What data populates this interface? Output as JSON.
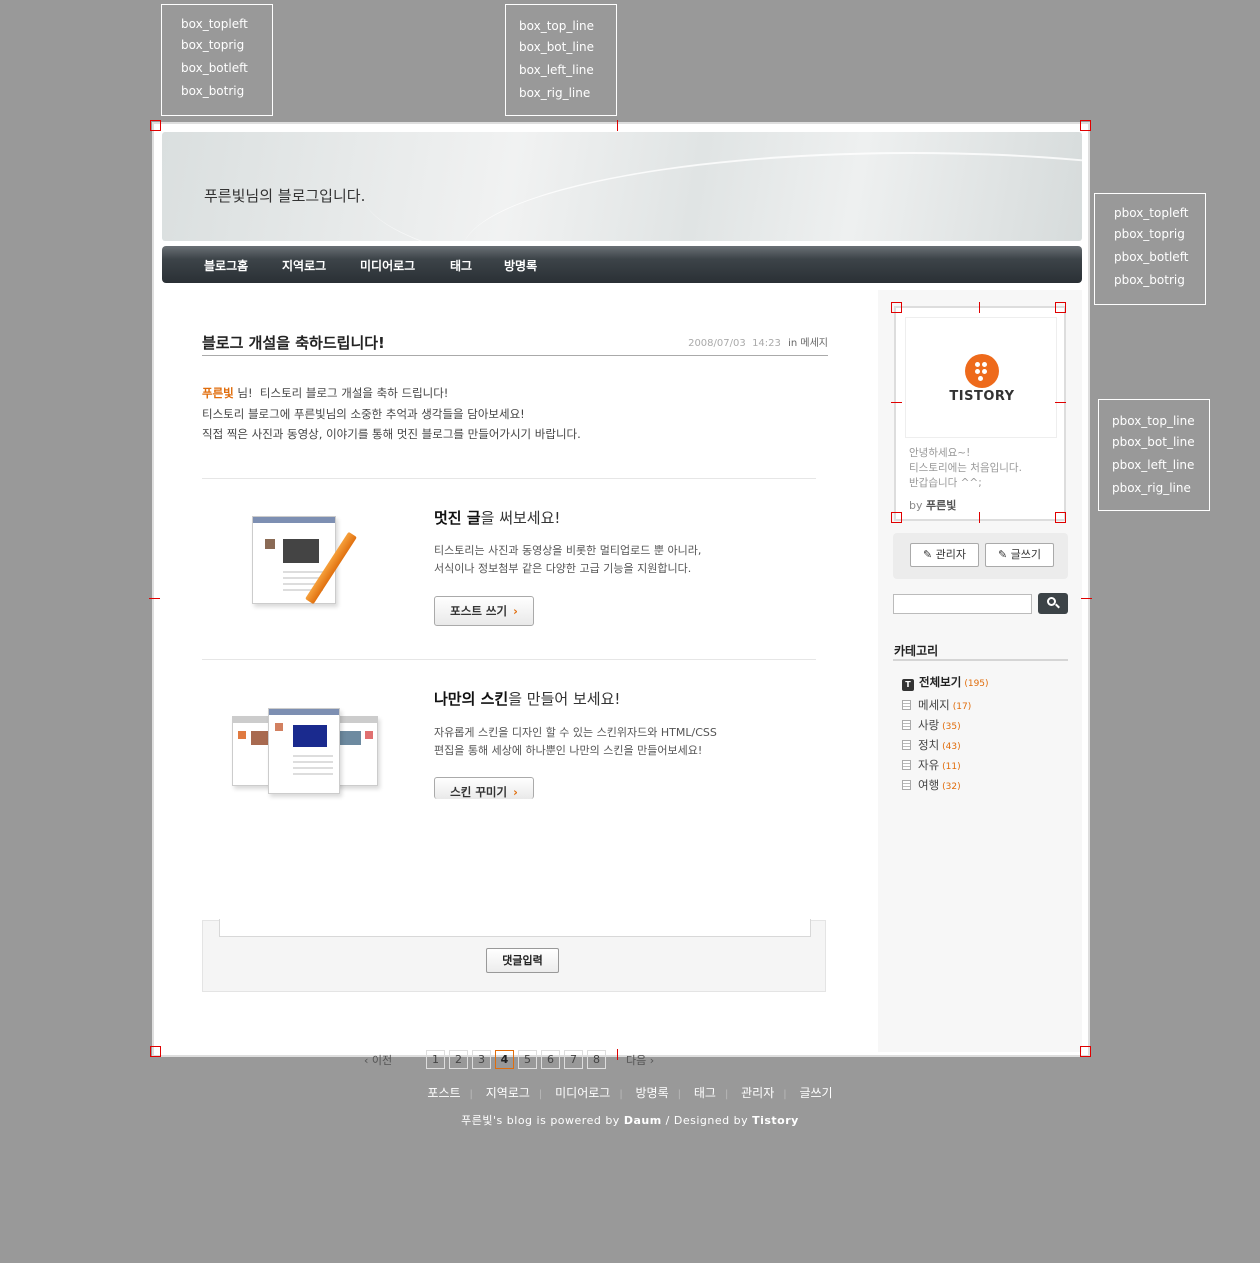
{
  "legend_box": [
    "box_topleft",
    "box_toprig",
    "box_botleft",
    "box_botrig"
  ],
  "legend_box_line": [
    "box_top_line",
    "box_bot_line",
    "box_left_line",
    "box_rig_line"
  ],
  "legend_pbox": [
    "pbox_topleft",
    "pbox_toprig",
    "pbox_botleft",
    "pbox_botrig"
  ],
  "legend_pbox_line": [
    "pbox_top_line",
    "pbox_bot_line",
    "pbox_left_line",
    "pbox_rig_line"
  ],
  "blog_title": "푸른빛님의 블로그입니다.",
  "nav": [
    "블로그홈",
    "지역로그",
    "미디어로그",
    "태그",
    "방명록"
  ],
  "post": {
    "title": "블로그 개설을 축하드립니다!",
    "date": "2008/07/03  14:23",
    "in_label": "in",
    "category": "메세지",
    "intro_name": "푸른빛",
    "intro_line1": " 님!  티스토리 블로그 개설을 축하 드립니다!",
    "intro_line2": "티스토리 블로그에  푸른빛님의 소중한 추억과 생각들을 담아보세요!",
    "intro_line3": "직접 찍은 사진과 동영상, 이야기를 통해 멋진 블로그를 만들어가시기 바랍니다."
  },
  "feature1": {
    "title_bold": "멋진 글",
    "title_rest": "을 써보세요!",
    "desc1": "티스토리는 사진과 동영상을 비롯한 멀티업로드 뿐 아니라,",
    "desc2": "서식이나 정보첨부 같은 다양한 고급 기능을 지원합니다.",
    "button": "포스트 쓰기"
  },
  "feature2": {
    "title_bold": "나만의 스킨",
    "title_rest": "을 만들어 보세요!",
    "desc1": "자유롭게 스킨을 디자인 할 수 있는 스킨위자드와 HTML/CSS",
    "desc2": "편집을 통해 세상에 하나뿐인 나만의 스킨을 만들어보세요!",
    "button": "스킨 꾸미기"
  },
  "comment_button": "댓글입력",
  "pager": {
    "prev": "이전",
    "next": "다음",
    "pages": [
      "1",
      "2",
      "3",
      "4",
      "5",
      "6",
      "7",
      "8"
    ],
    "current": "4"
  },
  "profile": {
    "logo_text": "TISTORY",
    "msg1": "안녕하세요~!",
    "msg2": "티스토리에는 처음입니다.",
    "msg3": "반갑습니다 ^^;",
    "by_label": "by",
    "by_name": "푸른빛"
  },
  "admin_button": "관리자",
  "write_button": "글쓰기",
  "search_value": "",
  "category": {
    "title": "카테고리",
    "all_label": "전체보기",
    "all_count": "(195)",
    "items": [
      {
        "label": "메세지",
        "count": "(17)"
      },
      {
        "label": "사랑",
        "count": "(35)"
      },
      {
        "label": "정치",
        "count": "(43)"
      },
      {
        "label": "자유",
        "count": "(11)"
      },
      {
        "label": "여행",
        "count": "(32)"
      }
    ]
  },
  "footer": {
    "links": [
      "포스트",
      "지역로그",
      "미디어로그",
      "방명록",
      "태그",
      "관리자",
      "글쓰기"
    ],
    "credit_prefix": "푸른빛's blog is powered by ",
    "credit_daum": "Daum",
    "credit_mid": " / Designed by ",
    "credit_tistory": "Tistory"
  },
  "colors": {
    "accent": "#e06d0c",
    "background": "#999999",
    "marker": "#e00000"
  }
}
